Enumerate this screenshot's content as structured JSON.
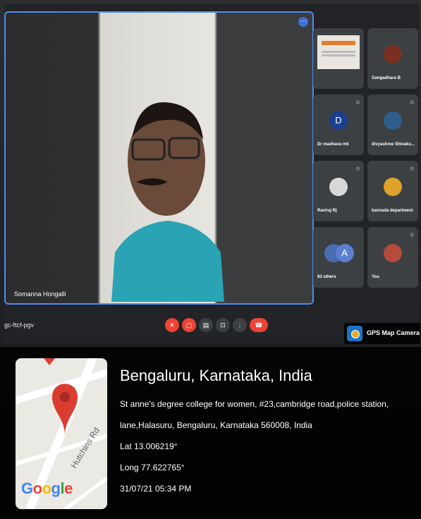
{
  "meeting": {
    "speaker_name": "Somanna Hongalli",
    "meeting_code": "gc-ftcf-pgv",
    "more_options": "⋯",
    "participants": [
      {
        "name": "",
        "initial": ""
      },
      {
        "name": "Gangadhara B",
        "initial": ""
      },
      {
        "name": "Dr madhava mk",
        "initial": "D"
      },
      {
        "name": "divyashree Shivaku...",
        "initial": ""
      },
      {
        "name": "Raviraj Rj",
        "initial": ""
      },
      {
        "name": "kannada department",
        "initial": ""
      },
      {
        "name": "83 others",
        "initial": "A"
      },
      {
        "name": "You",
        "initial": ""
      }
    ],
    "controls": {
      "mic_icon": "microphone-off-icon",
      "camera_icon": "camera-off-icon",
      "captions_icon": "captions-icon",
      "present_icon": "present-icon",
      "more_icon": "more-vert-icon",
      "leave_icon": "hang-up-icon"
    },
    "colors": {
      "accent": "#4e8cf4",
      "danger": "#ea4335"
    }
  },
  "gps_badge": {
    "title": "GPS Map Camera"
  },
  "location": {
    "title": "Bengaluru, Karnataka, India",
    "address_line1": "St anne's degree college for women, #23,cambridge road,police station,",
    "address_line2": "lane,Halasuru, Bengaluru, Karnataka 560008, India",
    "lat": "Lat 13.006219°",
    "long": "Long 77.622765°",
    "datetime": "31/07/21 05:34 PM"
  },
  "map": {
    "street_label": "Hutchins Rd",
    "logo_text": "Google",
    "pin_color": "#db3c30"
  }
}
